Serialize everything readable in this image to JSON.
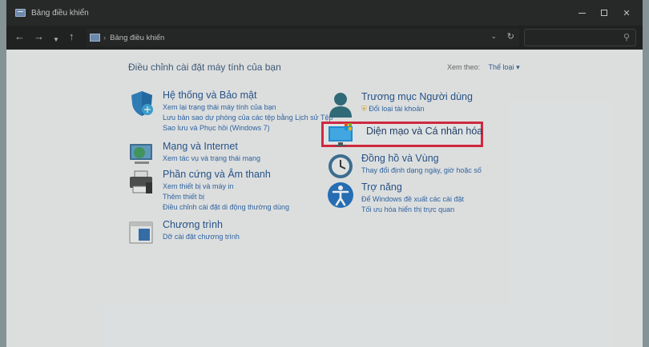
{
  "window": {
    "title": "Bảng điều khiển"
  },
  "navbar": {
    "breadcrumb": "Bảng điều khiển",
    "search_placeholder": ""
  },
  "content": {
    "heading": "Điều chỉnh cài đặt máy tính của bạn",
    "view_by_label": "Xem theo:",
    "view_by_value": "Thể loại"
  },
  "categories": {
    "system": {
      "title": "Hệ thống và Bảo mật",
      "links": [
        "Xem lại trạng thái máy tính của bạn",
        "Lưu bản sao dự phòng của các tệp bằng Lịch sử Tệp",
        "Sao lưu và Phục hồi (Windows 7)"
      ]
    },
    "network": {
      "title": "Mạng và Internet",
      "links": [
        "Xem tác vụ và trạng thái mạng"
      ]
    },
    "hardware": {
      "title": "Phần cứng và Âm thanh",
      "links": [
        "Xem thiết bị và máy in",
        "Thêm thiết bị",
        "Điều chỉnh cài đặt di động thường dùng"
      ]
    },
    "programs": {
      "title": "Chương trình",
      "links": [
        "Dỡ cài đặt chương trình"
      ]
    },
    "users": {
      "title": "Trương mục Người dùng",
      "links": [
        "Đổi loại tài khoản"
      ]
    },
    "appearance": {
      "title": "Diện mạo và Cá nhân hóa"
    },
    "clock": {
      "title": "Đồng hồ và Vùng",
      "links": [
        "Thay đổi định dạng ngày, giờ hoặc số"
      ]
    },
    "ease": {
      "title": "Trợ năng",
      "links": [
        "Để Windows đề xuất các cài đặt",
        "Tối ưu hóa hiển thị trực quan"
      ]
    }
  },
  "colors": {
    "highlight": "#e0203c",
    "link": "#2a63a8",
    "title_link": "#1e4f8b"
  }
}
